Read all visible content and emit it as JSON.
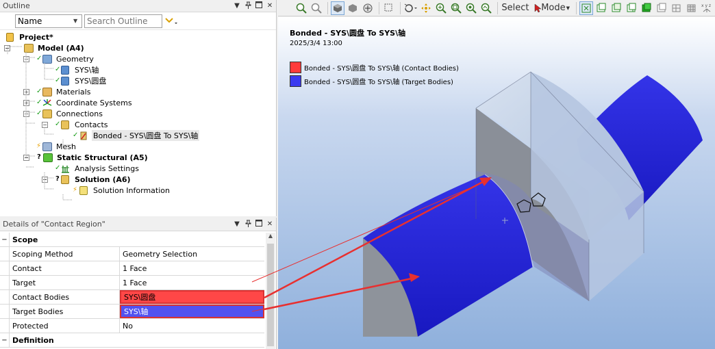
{
  "outline": {
    "title": "Outline",
    "name_filter": "Name",
    "search_placeholder": "Search Outline",
    "tree": [
      {
        "label": "Project*"
      },
      {
        "label": "Model (A4)"
      },
      {
        "label": "Geometry"
      },
      {
        "label": "SYS\\轴"
      },
      {
        "label": "SYS\\圆盘"
      },
      {
        "label": "Materials"
      },
      {
        "label": "Coordinate Systems"
      },
      {
        "label": "Connections"
      },
      {
        "label": "Contacts"
      },
      {
        "label": "Bonded - SYS\\圆盘 To SYS\\轴"
      },
      {
        "label": "Mesh"
      },
      {
        "label": "Static Structural (A5)"
      },
      {
        "label": "Analysis Settings"
      },
      {
        "label": "Solution (A6)"
      },
      {
        "label": "Solution Information"
      }
    ]
  },
  "details": {
    "title": "Details of \"Contact Region\"",
    "rows": [
      {
        "label": "Scope",
        "value": ""
      },
      {
        "label": "Scoping Method",
        "value": "Geometry Selection"
      },
      {
        "label": "Contact",
        "value": "1 Face"
      },
      {
        "label": "Target",
        "value": "1 Face"
      },
      {
        "label": "Contact Bodies",
        "value": "SYS\\圆盘"
      },
      {
        "label": "Target Bodies",
        "value": "SYS\\轴"
      },
      {
        "label": "Protected",
        "value": "No"
      },
      {
        "label": "Definition",
        "value": ""
      }
    ]
  },
  "toolbar": {
    "select_label": "Select",
    "mode_label": "Mode"
  },
  "viewport": {
    "title": "Bonded - SYS\\圆盘 To SYS\\轴",
    "date": "2025/3/4 13:00",
    "legend": [
      {
        "label": "Bonded - SYS\\圆盘 To SYS\\轴 (Contact Bodies)",
        "color": "#ff3b3b"
      },
      {
        "label": "Bonded - SYS\\圆盘 To SYS\\轴 (Target Bodies)",
        "color": "#3a3af0"
      }
    ]
  },
  "colors": {
    "contact": "#ff4747",
    "target": "#5252f0",
    "shaft": "#2424d8",
    "disk": "#b8c8e0",
    "arrow": "#e83030"
  }
}
